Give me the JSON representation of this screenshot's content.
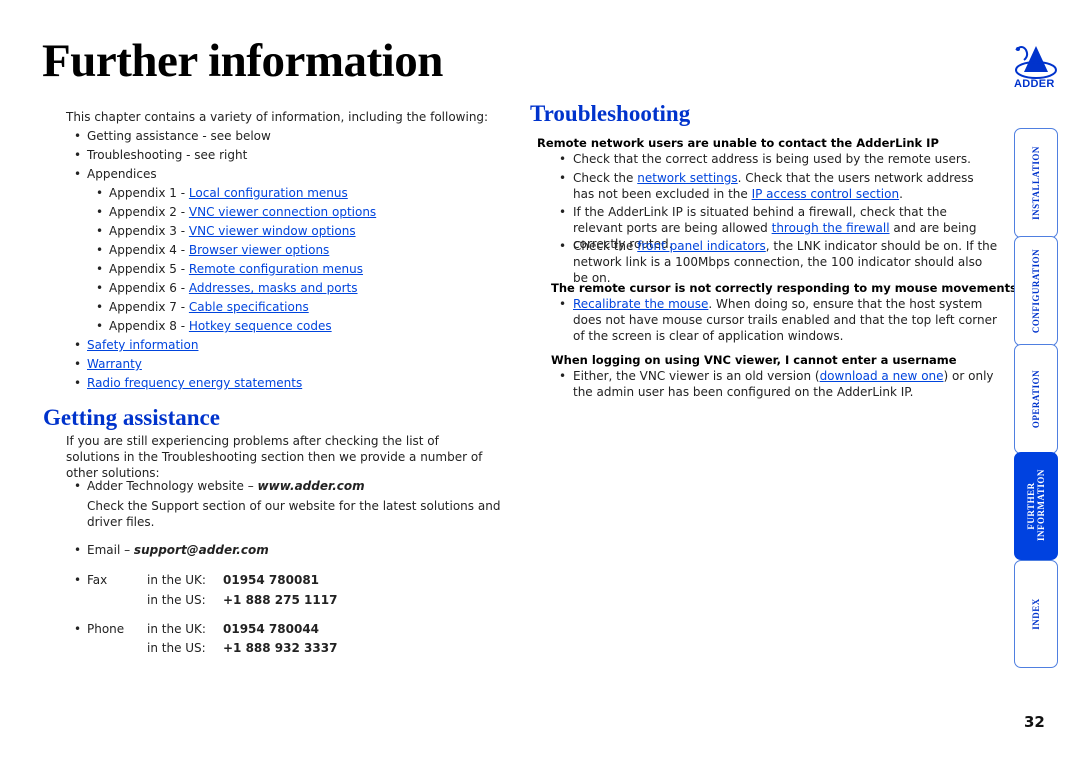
{
  "page": {
    "title": "Further information",
    "page_number": "32",
    "brand": "ADDER"
  },
  "intro": {
    "text": "This chapter contains a variety of information, including the following:",
    "items": [
      {
        "prefix": "Getting assistance - see below",
        "link": ""
      },
      {
        "prefix": "Troubleshooting - see right",
        "link": ""
      },
      {
        "prefix": "Appendices",
        "link": ""
      }
    ],
    "appendices": [
      {
        "prefix": "Appendix 1 - ",
        "link": "Local configuration menus"
      },
      {
        "prefix": "Appendix 2 - ",
        "link": "VNC viewer connection options"
      },
      {
        "prefix": "Appendix 3 - ",
        "link": "VNC viewer window options"
      },
      {
        "prefix": "Appendix 4 - ",
        "link": "Browser viewer options"
      },
      {
        "prefix": "Appendix 5 - ",
        "link": "Remote configuration menus"
      },
      {
        "prefix": "Appendix 6 - ",
        "link": "Addresses, masks and ports"
      },
      {
        "prefix": "Appendix 7 - ",
        "link": "Cable specifications"
      },
      {
        "prefix": "Appendix 8 - ",
        "link": "Hotkey sequence codes"
      }
    ],
    "extra_links": [
      "Safety information",
      "Warranty",
      "Radio frequency energy statements"
    ]
  },
  "assistance": {
    "heading": "Getting assistance",
    "intro": "If you are still experiencing problems after checking the list of solutions in the Troubleshooting section then we provide a number of other solutions:",
    "website_label": "Adder Technology website – ",
    "website": "www.adder.com",
    "website_desc": "Check the Support section of our website for the latest solutions and driver files.",
    "email_label": "Email – ",
    "email": "support@adder.com",
    "fax": {
      "label": "Fax",
      "uk_label": "in the UK:",
      "uk": "01954 780081",
      "us_label": "in the US:",
      "us": "+1 888 275 1117"
    },
    "phone": {
      "label": "Phone",
      "uk_label": "in the UK:",
      "uk": "01954 780044",
      "us_label": "in the US:",
      "us": "+1 888 932 3337"
    }
  },
  "troubleshooting": {
    "heading": "Troubleshooting",
    "q1": {
      "title": "Remote network users are unable to contact the AdderLink IP",
      "b1": "Check that the correct address is being used by the remote users.",
      "b2_pre": "Check the ",
      "b2_link1": "network settings",
      "b2_mid": ". Check that the users network address has not been excluded in the ",
      "b2_link2": "IP access control section",
      "b2_post": ".",
      "b3_pre": "If the AdderLink IP is situated behind a firewall, check that the relevant ports are being allowed ",
      "b3_link": "through the firewall",
      "b3_post": " and are being correctly routed.",
      "b4_pre": "Check the ",
      "b4_link": "front panel indicators",
      "b4_post": ", the LNK indicator should be on. If the network link is a 100Mbps connection, the 100 indicator should also be on."
    },
    "q2": {
      "title": "The remote cursor is not correctly responding to my mouse movements",
      "b1_link": "Recalibrate the mouse",
      "b1_post": ". When doing so, ensure that the host system does not have mouse cursor trails enabled and that the top left corner of the screen is clear of application windows."
    },
    "q3": {
      "title": "When logging on using VNC viewer, I cannot enter a username",
      "b1_pre": "Either, the VNC viewer is an old version (",
      "b1_link": "download a new one",
      "b1_post": ") or only the admin user has been configured on the AdderLink IP."
    }
  },
  "side_tabs": [
    {
      "label": "INSTALLATION",
      "active": false
    },
    {
      "label": "CONFIGURATION",
      "active": false
    },
    {
      "label": "OPERATION",
      "active": false
    },
    {
      "label": "FURTHER INFORMATION",
      "active": true
    },
    {
      "label": "INDEX",
      "active": false
    }
  ],
  "colors": {
    "accent": "#0033cc",
    "link": "#0044dd",
    "active_tab": "#0042e0"
  }
}
